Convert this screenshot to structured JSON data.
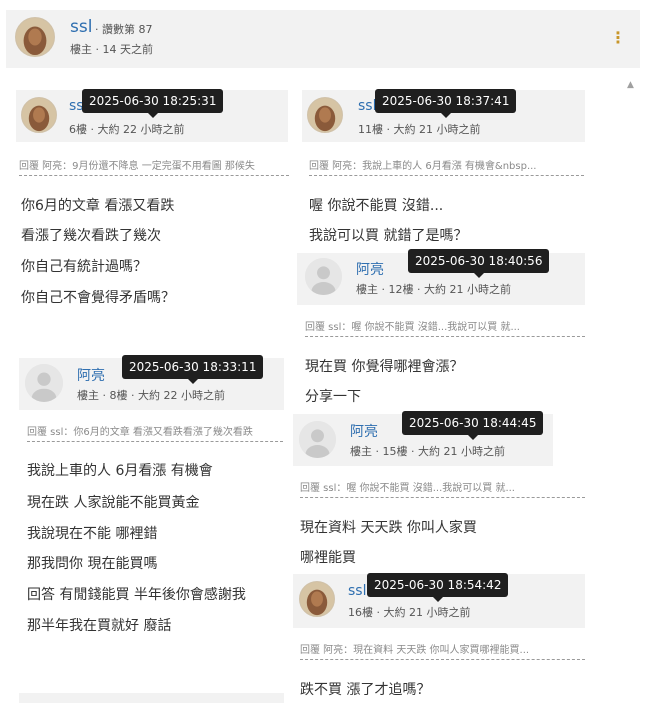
{
  "header": {
    "username": "ssl",
    "badge": "· 讚數第 87",
    "meta": "樓主 · 14 天之前",
    "menu_icon": "kebab-icon"
  },
  "posts": [
    {
      "user": "ssl",
      "meta": "6樓 · 大約 22 小時之前",
      "tooltip": "2025-06-30 18:25:31",
      "quote": "回覆 阿亮：9月份還不降息 一定完蛋不用看圖 那候失",
      "lines": [
        "你6月的文章 看漲又看跌",
        "看漲了幾次看跌了幾次",
        "你自己有統計過嗎？",
        "你自己不會覺得矛盾嗎？"
      ]
    },
    {
      "user": "阿亮",
      "meta": "樓主 · 8樓 · 大約 22 小時之前",
      "tooltip": "2025-06-30 18:33:11",
      "quote": "回覆 ssl：你6月的文章 看漲又看跌看漲了幾次看跌",
      "lines": [
        "我說上車的人 6月看漲 有機會",
        "現在跌 人家說能不能買黃金",
        "我說現在不能 哪裡錯",
        "那我問你 現在能買嗎",
        "回答 有閒錢能買 半年後你會感謝我",
        "那半年我在買就好 廢話"
      ]
    },
    {
      "user": "ssl",
      "meta": "11樓 · 大約 21 小時之前",
      "tooltip": "2025-06-30 18:37:41",
      "quote": "回覆 阿亮：我說上車的人 6月看漲 有機會&nbsp...",
      "lines": [
        "喔 你說不能買 沒錯...",
        "我說可以買 就錯了是嗎？"
      ]
    },
    {
      "user": "阿亮",
      "meta": "樓主 · 12樓 · 大約 21 小時之前",
      "tooltip": "2025-06-30 18:40:56",
      "quote": "回覆 ssl：喔 你說不能買 沒錯...我說可以買 就...",
      "lines": [
        "現在買 你覺得哪裡會漲？",
        "分享一下"
      ]
    },
    {
      "user": "阿亮",
      "meta": "樓主 · 15樓 · 大約 21 小時之前",
      "tooltip": "2025-06-30 18:44:45",
      "quote": "回覆 ssl：喔 你說不能買 沒錯...我說可以買 就...",
      "lines": [
        "現在資料 天天跌 你叫人家買",
        "哪裡能買"
      ]
    },
    {
      "user": "ssl",
      "meta": "16樓 · 大約 21 小時之前",
      "tooltip": "2025-06-30 18:54:42",
      "quote": "回覆 阿亮：現在資料 天天跌 你叫人家買哪裡能買...",
      "lines": [
        "跌不買 漲了才追嗎？"
      ]
    }
  ],
  "colors": {
    "username": "#2f6fb0",
    "card_bg": "#f2f2f2",
    "tooltip_bg": "#1f1f1f",
    "menu": "#c8962a"
  }
}
